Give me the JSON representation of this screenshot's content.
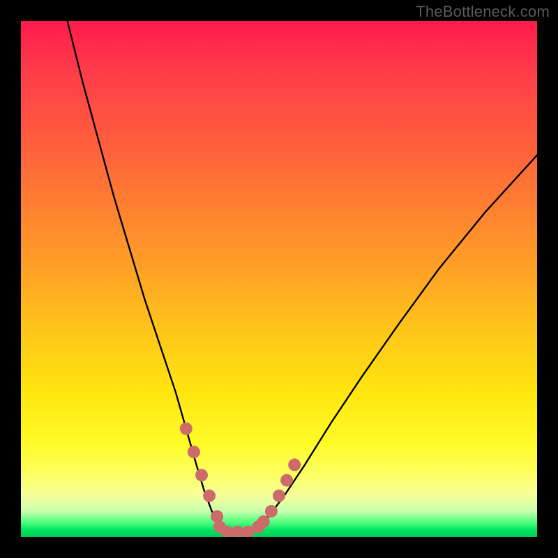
{
  "branding": "TheBottleneck.com",
  "colors": {
    "page_bg": "#000000",
    "gradient_top": "#ff1a4d",
    "gradient_mid": "#ffe60f",
    "gradient_bottom": "#00c853",
    "curve_stroke": "#000000",
    "marker_fill": "#cd6a6a"
  },
  "chart_data": {
    "type": "line",
    "title": "",
    "xlabel": "",
    "ylabel": "",
    "xlim": [
      0,
      100
    ],
    "ylim": [
      0,
      100
    ],
    "grid": false,
    "series": [
      {
        "name": "left-branch",
        "x": [
          9,
          12,
          15,
          18,
          21,
          24,
          27,
          30,
          32,
          34,
          35.5,
          37,
          38.5
        ],
        "values": [
          100,
          88,
          77,
          66,
          56,
          46,
          37,
          28,
          21,
          14,
          9,
          5,
          2
        ]
      },
      {
        "name": "valley-floor",
        "x": [
          38.5,
          40,
          42,
          44,
          46
        ],
        "values": [
          2,
          1,
          1,
          1,
          2
        ]
      },
      {
        "name": "right-branch",
        "x": [
          46,
          48,
          51,
          55,
          60,
          66,
          73,
          81,
          90,
          100
        ],
        "values": [
          2,
          4,
          8,
          14,
          22,
          31,
          41,
          52,
          63,
          74
        ]
      }
    ],
    "annotations": [
      {
        "name": "highlight-left-approach",
        "type": "marker-strip",
        "x": [
          32,
          33.5,
          35,
          36.5,
          38
        ],
        "values": [
          21,
          16.5,
          12,
          8,
          4
        ]
      },
      {
        "name": "highlight-floor",
        "type": "marker-strip",
        "x": [
          38.5,
          40,
          42,
          44,
          46
        ],
        "values": [
          2,
          1,
          1,
          1,
          2
        ]
      },
      {
        "name": "highlight-right-approach",
        "type": "marker-strip",
        "x": [
          47,
          48.5,
          50,
          51.5,
          53
        ],
        "values": [
          3,
          5,
          8,
          11,
          14
        ]
      }
    ]
  }
}
